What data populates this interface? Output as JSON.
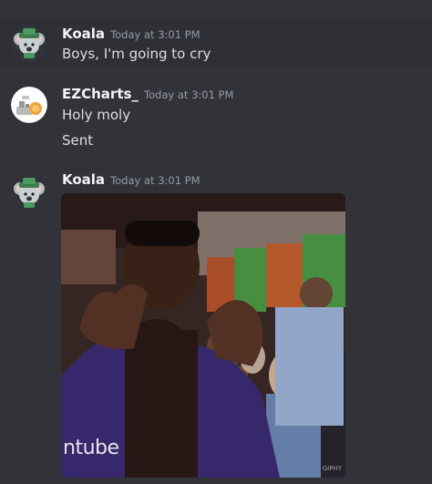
{
  "messages": [
    {
      "author": "Koala",
      "timestamp": "Today at 3:01 PM",
      "lines": [
        "Boys, I'm going to cry"
      ],
      "avatar_icon": "koala-avatar-icon"
    },
    {
      "author": "EZCharts_",
      "timestamp": "Today at 3:01 PM",
      "lines": [
        "Holy moly",
        "Sent"
      ],
      "avatar_icon": "ezcharts-avatar-icon"
    },
    {
      "author": "Koala",
      "timestamp": "Today at 3:01 PM",
      "lines": [],
      "avatar_icon": "koala-avatar-icon",
      "attachment": {
        "type": "gif",
        "watermark_left": "ntube",
        "watermark_right": "GIPHY"
      }
    }
  ],
  "colors": {
    "background": "#313338",
    "username": "#f2f3f5",
    "timestamp": "#949ba4",
    "text": "#dbdee1"
  }
}
